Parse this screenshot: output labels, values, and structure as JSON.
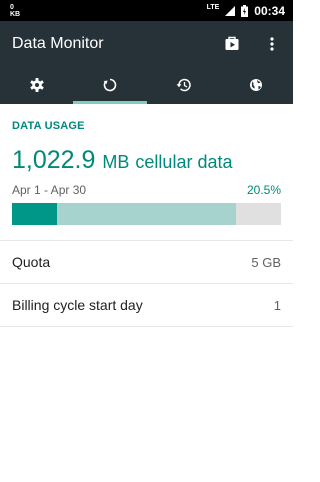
{
  "status_bar": {
    "data_rate": "0",
    "data_unit": "KB",
    "network": "LTE",
    "time": "00:34"
  },
  "app_bar": {
    "title": "Data Monitor",
    "actions": [
      {
        "name": "store-icon"
      },
      {
        "name": "more-vert-icon"
      }
    ]
  },
  "tabs": [
    {
      "name": "settings-icon",
      "active": false
    },
    {
      "name": "cycle-icon",
      "active": true
    },
    {
      "name": "history-icon",
      "active": false
    },
    {
      "name": "globe-icon",
      "active": false
    }
  ],
  "usage": {
    "section_label": "DATA USAGE",
    "amount": "1,022.9",
    "unit": "MB",
    "description": "cellular data",
    "period": "Apr 1 - Apr 30",
    "percent": "20.5%",
    "used_fraction": 0.167,
    "period_elapsed_fraction": 0.834
  },
  "settings": [
    {
      "label": "Quota",
      "value": "5 GB"
    },
    {
      "label": "Billing cycle start day",
      "value": "1"
    }
  ],
  "colors": {
    "accent": "#00897b",
    "app_bar": "#263238",
    "tab_indicator": "#80cbc4",
    "progress_primary": "#009688",
    "progress_secondary": "#a7d3cf",
    "progress_track": "#e0e0e0"
  }
}
